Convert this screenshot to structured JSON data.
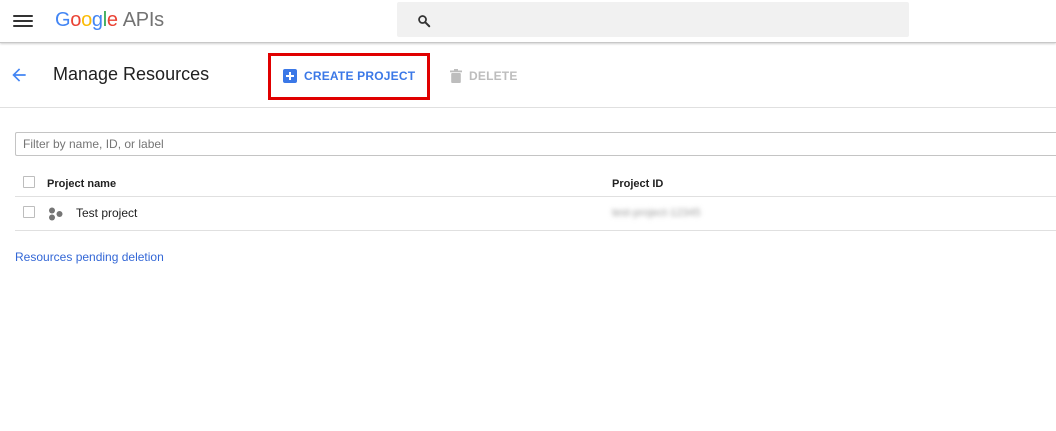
{
  "topbar": {
    "logo_letters": [
      "G",
      "o",
      "o",
      "g",
      "l",
      "e"
    ],
    "logo_suffix": "APIs",
    "search_value": ""
  },
  "header": {
    "title": "Manage Resources",
    "create_label": "CREATE PROJECT",
    "delete_label": "DELETE"
  },
  "filter": {
    "placeholder": "Filter by name, ID, or label",
    "value": ""
  },
  "table": {
    "columns": [
      "Project name",
      "Project ID"
    ],
    "rows": [
      {
        "name": "Test project",
        "id": "test-project-12345"
      }
    ]
  },
  "links": {
    "pending": "Resources pending deletion"
  },
  "colors": {
    "accent": "#3b78e7",
    "highlight": "#e00000",
    "disabled": "#bdbdbd"
  },
  "icons": {
    "menu": "hamburger-icon",
    "search": "search-icon",
    "back": "arrow-left-icon",
    "create": "plus-square-icon",
    "delete": "trash-icon",
    "project": "project-dots-icon"
  }
}
